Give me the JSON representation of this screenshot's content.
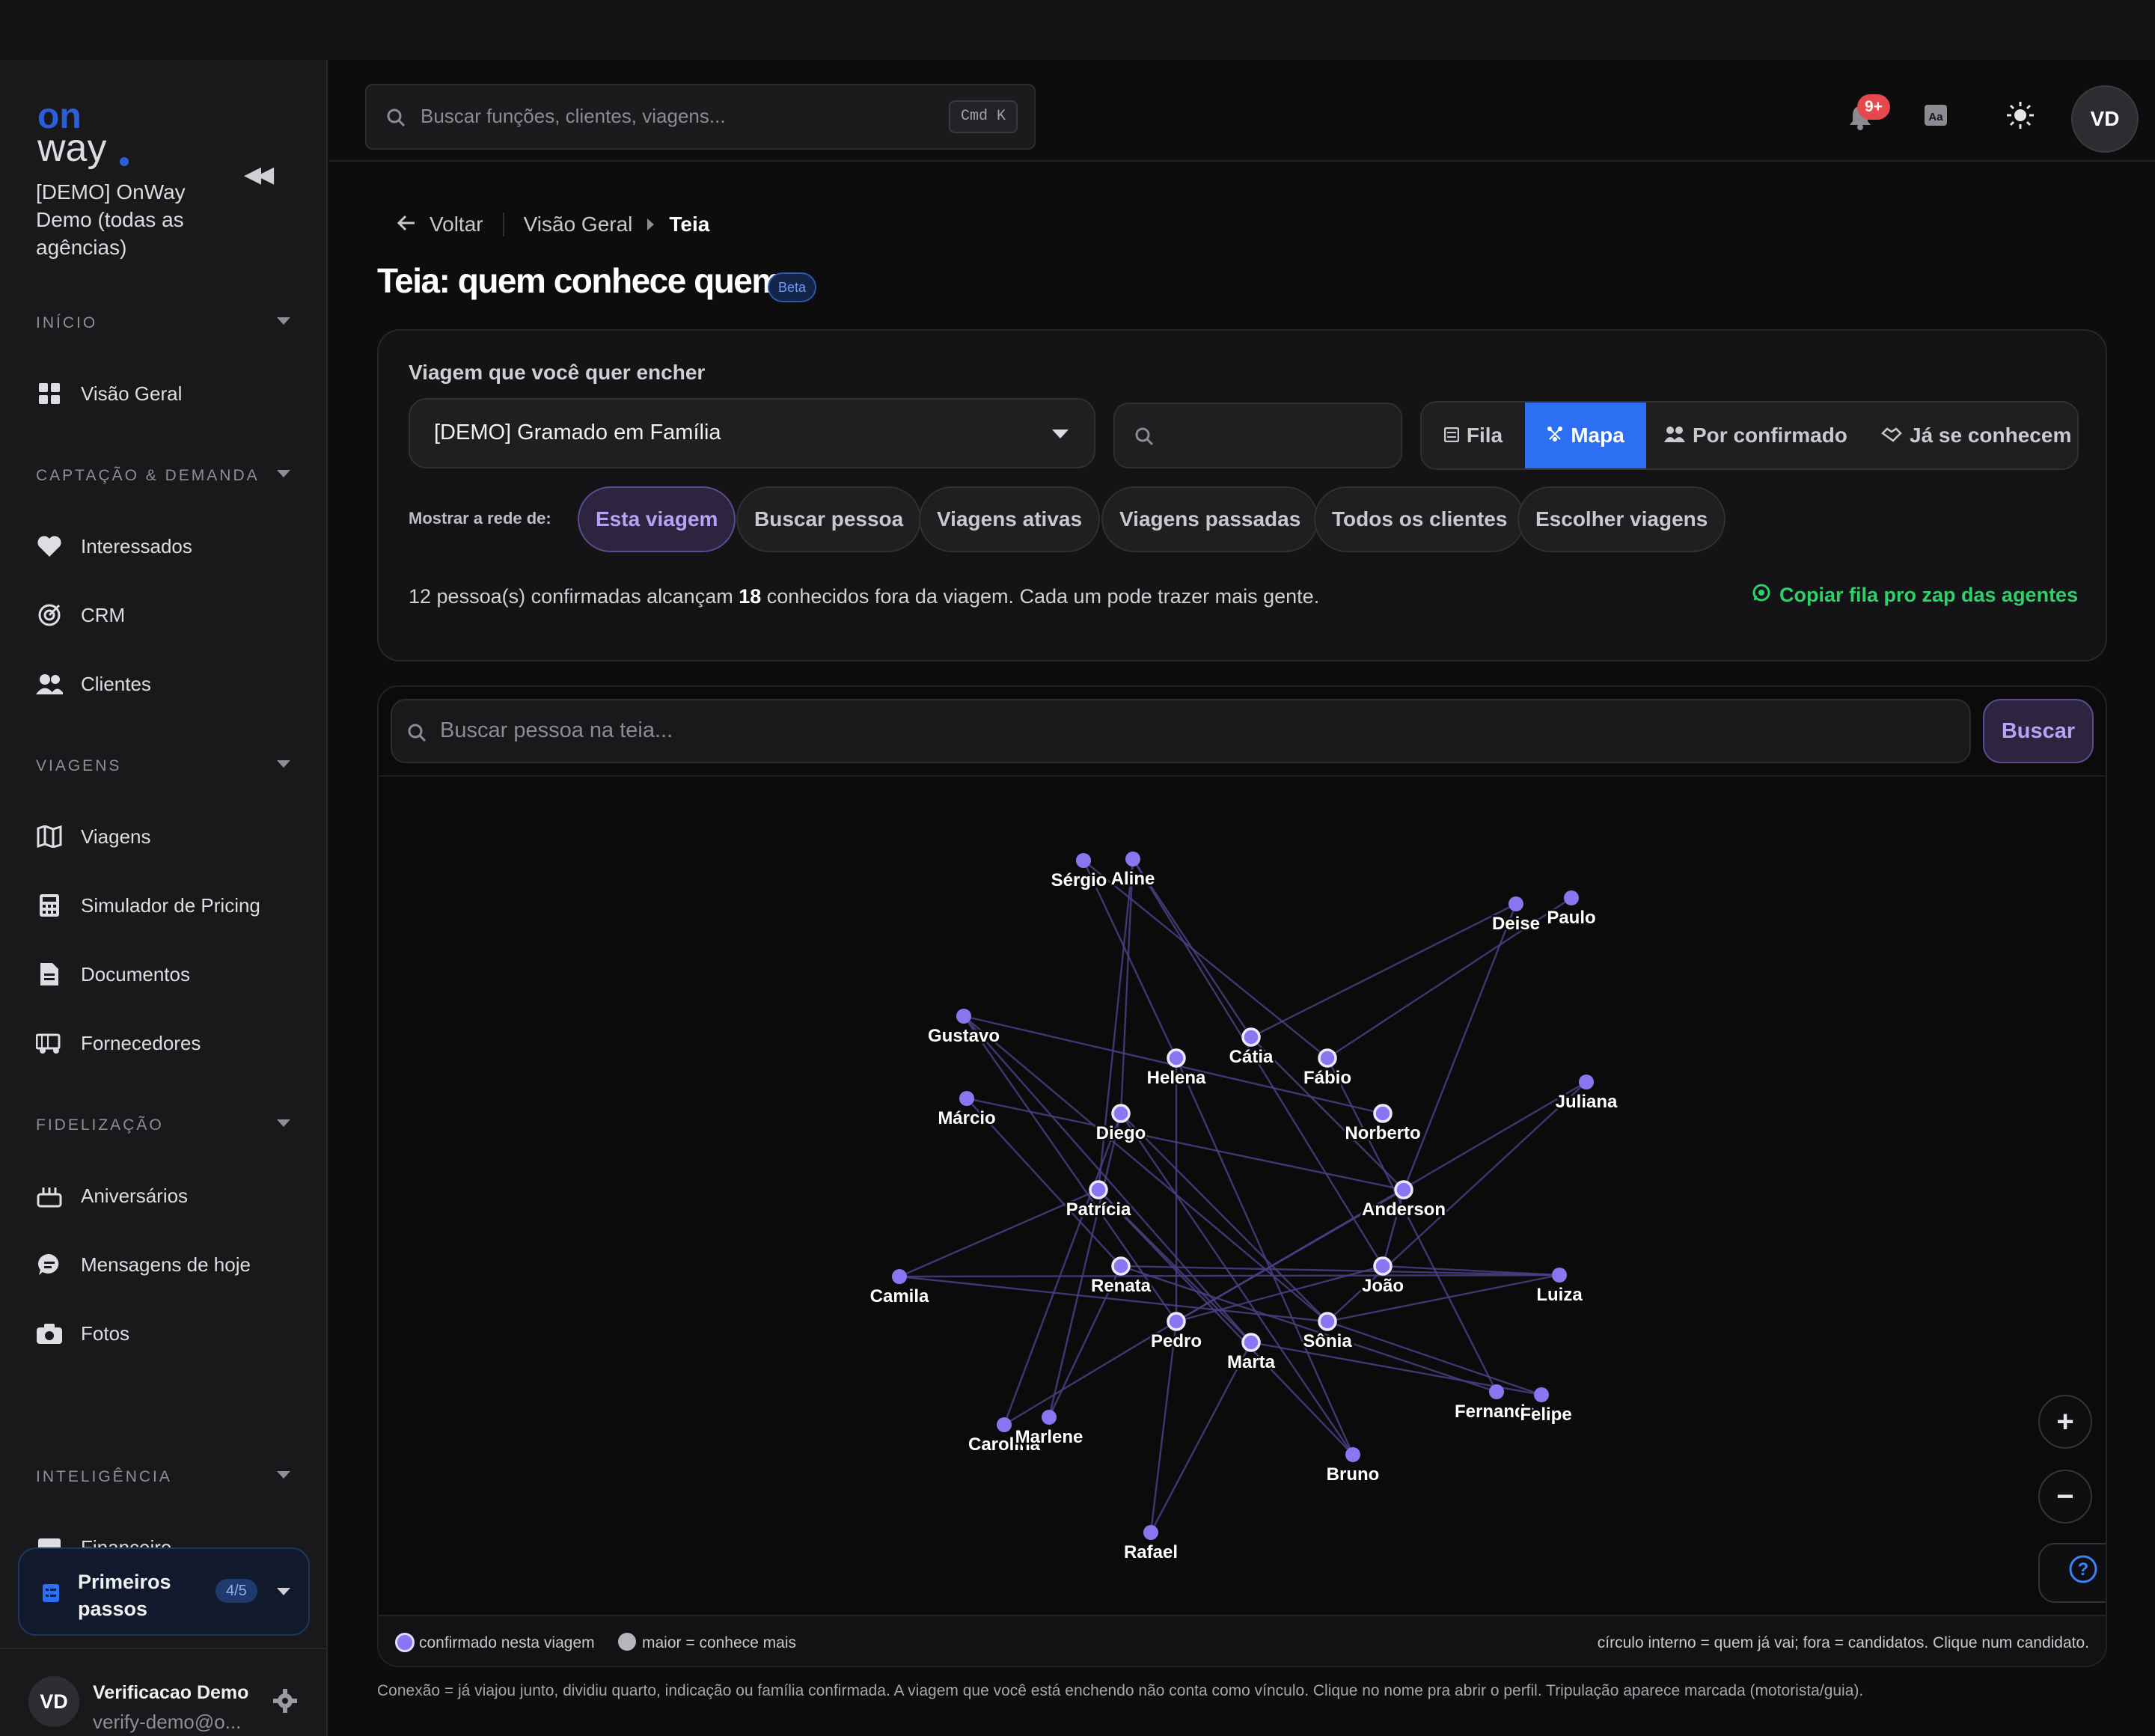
{
  "sidebar": {
    "logo_top": "on",
    "logo_bottom": "way",
    "org_name": "[DEMO] OnWay Demo (todas as agências)",
    "sections": [
      {
        "label": "INÍCIO",
        "items": [
          {
            "label": "Visão Geral",
            "icon": "grid-icon"
          }
        ]
      },
      {
        "label": "CAPTAÇÃO & DEMANDA",
        "items": [
          {
            "label": "Interessados",
            "icon": "heart-icon"
          },
          {
            "label": "CRM",
            "icon": "target-icon"
          },
          {
            "label": "Clientes",
            "icon": "users-icon"
          }
        ]
      },
      {
        "label": "VIAGENS",
        "items": [
          {
            "label": "Viagens",
            "icon": "map-icon"
          },
          {
            "label": "Simulador de Pricing",
            "icon": "calculator-icon"
          },
          {
            "label": "Documentos",
            "icon": "document-icon"
          },
          {
            "label": "Fornecedores",
            "icon": "truck-icon"
          }
        ]
      },
      {
        "label": "FIDELIZAÇÃO",
        "items": [
          {
            "label": "Aniversários",
            "icon": "cake-icon"
          },
          {
            "label": "Mensagens de hoje",
            "icon": "chat-icon"
          },
          {
            "label": "Fotos",
            "icon": "camera-icon"
          }
        ]
      },
      {
        "label": "INTELIGÊNCIA",
        "items": [
          {
            "label": "Financeiro",
            "icon": "chart-icon"
          }
        ]
      }
    ],
    "first_steps": {
      "label": "Primeiros passos",
      "badge": "4/5"
    },
    "user": {
      "initials": "VD",
      "name": "Verificacao Demo",
      "email": "verify-demo@o..."
    }
  },
  "header": {
    "search_placeholder": "Buscar funções, clientes, viagens...",
    "shortcut": "Cmd K",
    "notifications_badge": "9+",
    "avatar_initials": "VD"
  },
  "breadcrumb": {
    "back": "Voltar",
    "parent": "Visão Geral",
    "current": "Teia"
  },
  "page": {
    "title": "Teia: quem conhece quem",
    "badge": "Beta"
  },
  "trip_panel": {
    "label": "Viagem que você quer encher",
    "selected_trip": "[DEMO] Gramado em Família",
    "view_modes": [
      {
        "label": "Fila",
        "icon": "list-icon",
        "active": false
      },
      {
        "label": "Mapa",
        "icon": "network-icon",
        "active": true
      },
      {
        "label": "Por confirmado",
        "icon": "people-icon",
        "active": false
      },
      {
        "label": "Já se conhecem",
        "icon": "handshake-icon",
        "active": false
      }
    ],
    "network_label": "Mostrar a rede de:",
    "network_options": [
      {
        "label": "Esta viagem",
        "active": true
      },
      {
        "label": "Buscar pessoa",
        "active": false
      },
      {
        "label": "Viagens ativas",
        "active": false
      },
      {
        "label": "Viagens passadas",
        "active": false
      },
      {
        "label": "Todos os clientes",
        "active": false
      },
      {
        "label": "Escolher viagens",
        "active": false
      }
    ],
    "summary_pre": "12 pessoa(s) confirmadas alcançam",
    "summary_count": "18",
    "summary_post": "conhecidos fora da viagem. Cada um pode trazer mais gente.",
    "copy_action": "Copiar fila pro zap das agentes"
  },
  "graph": {
    "search_placeholder": "Buscar pessoa na teia...",
    "search_button": "Buscar",
    "confirmed": [
      "Helena",
      "Cátia",
      "Fábio",
      "Diego",
      "Norberto",
      "Patrícia",
      "Anderson",
      "Renata",
      "João",
      "Pedro",
      "Marta",
      "Sônia"
    ],
    "candidates": [
      "Sérgio",
      "Aline",
      "Deise",
      "Paulo",
      "Gustavo",
      "Márcio",
      "Juliana",
      "Camila",
      "Luiza",
      "Fernanda",
      "Felipe",
      "Carolina",
      "Marlene",
      "Bruno",
      "Rafael"
    ],
    "legend_confirmed": "confirmado nesta viagem",
    "legend_size": "maior = conhece mais",
    "legend_note": "círculo interno = quem já vai; fora = candidatos. Clique num candidato.",
    "accent": "#8b75f0"
  },
  "footnote": "Conexão = já viajou junto, dividiu quarto, indicação ou família confirmada. A viagem que você está enchendo não conta como vínculo. Clique no nome pra abrir o perfil. Tripulação aparece marcada (motorista/guia)."
}
